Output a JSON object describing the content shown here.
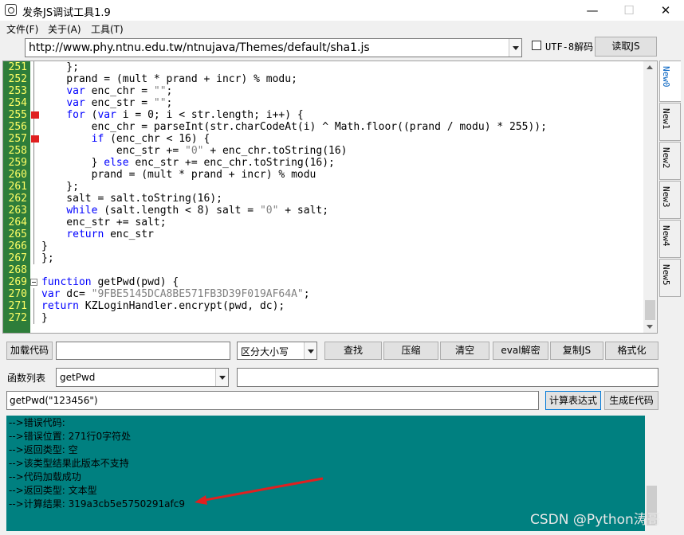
{
  "window": {
    "title": "发条JS调试工具1.9"
  },
  "menu": [
    "文件(F)",
    "关于(A)",
    "工具(T)"
  ],
  "url_bar": {
    "value": "http://www.phy.ntnu.edu.tw/ntnujava/Themes/default/sha1.js"
  },
  "utf8_checkbox": {
    "label": "UTF-8解码",
    "checked": false
  },
  "load_js_button": "读取JS",
  "tabs": [
    "New0",
    "New1",
    "New2",
    "New3",
    "New4",
    "New5"
  ],
  "editor": {
    "line_numbers": [
      "251",
      "252",
      "253",
      "254",
      "255",
      "256",
      "257",
      "258",
      "259",
      "260",
      "261",
      "262",
      "263",
      "264",
      "265",
      "266",
      "267",
      "268",
      "269",
      "270",
      "271",
      "272"
    ],
    "lines": [
      "    };",
      "    prand = (mult * prand + incr) % modu;",
      "    var enc_chr = \"\";",
      "    var enc_str = \"\";",
      "    for (var i = 0; i < str.length; i++) {",
      "        enc_chr = parseInt(str.charCodeAt(i) ^ Math.floor((prand / modu) * 255));",
      "        if (enc_chr < 16) {",
      "            enc_str += \"0\" + enc_chr.toString(16)",
      "        } else enc_str += enc_chr.toString(16);",
      "        prand = (mult * prand + incr) % modu",
      "    };",
      "    salt = salt.toString(16);",
      "    while (salt.length < 8) salt = \"0\" + salt;",
      "    enc_str += salt;",
      "    return enc_str",
      "}",
      "};",
      "",
      "function getPwd(pwd) {",
      "var dc= \"9FBE5145DCA8BE571FB3D39F019AF64A\";",
      "return KZLoginHandler.encrypt(pwd, dc);",
      "}"
    ]
  },
  "toolbar": {
    "load_code_button": "加载代码",
    "load_code_input": "",
    "case_select": "区分大小写",
    "find": "查找",
    "compress": "压缩",
    "clear": "清空",
    "eval_decode": "eval解密",
    "copy_js": "复制JS",
    "format": "格式化"
  },
  "function_list": {
    "label": "函数列表",
    "selected": "getPwd",
    "right_input": ""
  },
  "expression": {
    "value": "getPwd(\"123456\")",
    "calc_button": "计算表达式",
    "gen_button": "生成E代码"
  },
  "output_lines": [
    "-->错误代码:",
    "-->错误位置: 271行0字符处",
    "-->返回类型: 空",
    "-->该类型结果此版本不支持",
    "-->代码加载成功",
    "-->返回类型: 文本型",
    "-->计算结果: 319a3cb5e5750291afc9"
  ],
  "watermark": "CSDN @Python涛哥",
  "colors": {
    "gutter": "#2e7d3a",
    "line_numbers": "#ffff66",
    "output_bg": "#008080",
    "keyword": "#0000ff",
    "annotation_arrow": "#e02020"
  }
}
